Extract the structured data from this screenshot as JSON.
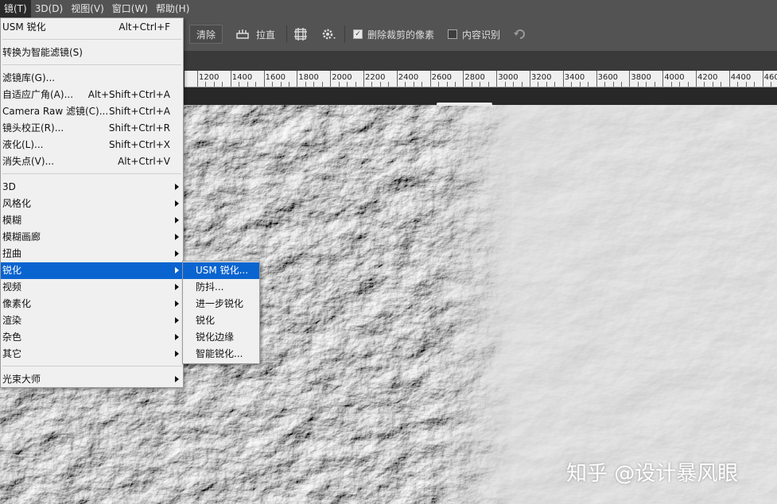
{
  "menubar": {
    "items": [
      {
        "label": "镜(T)",
        "active": true
      },
      {
        "label": "3D(D)"
      },
      {
        "label": "视图(V)"
      },
      {
        "label": "窗口(W)"
      },
      {
        "label": "帮助(H)"
      }
    ]
  },
  "options_bar": {
    "clear_label": "清除",
    "straighten_label": "拉直",
    "delete_cropped_label": "删除裁剪的像素",
    "delete_cropped_checked": true,
    "content_aware_label": "内容识别",
    "content_aware_checked": false
  },
  "ruler": {
    "labels": [
      "1200",
      "1400",
      "1600",
      "1800",
      "2000",
      "2200",
      "2400",
      "2600",
      "2800",
      "3000",
      "3200",
      "3400",
      "3600",
      "3800",
      "4000",
      "4200",
      "4400",
      "460"
    ]
  },
  "filter_menu": {
    "items": [
      {
        "label": "USM 锐化",
        "shortcut": "Alt+Ctrl+F"
      },
      {
        "label": "转换为智能滤镜(S)"
      },
      {
        "label": "滤镜库(G)..."
      },
      {
        "label": "自适应广角(A)...",
        "shortcut": "Alt+Shift+Ctrl+A"
      },
      {
        "label": "Camera Raw 滤镜(C)...",
        "shortcut": "Shift+Ctrl+A"
      },
      {
        "label": "镜头校正(R)...",
        "shortcut": "Shift+Ctrl+R"
      },
      {
        "label": "液化(L)...",
        "shortcut": "Shift+Ctrl+X"
      },
      {
        "label": "消失点(V)...",
        "shortcut": "Alt+Ctrl+V"
      },
      {
        "label": "3D"
      },
      {
        "label": "风格化"
      },
      {
        "label": "模糊"
      },
      {
        "label": "模糊画廊"
      },
      {
        "label": "扭曲"
      },
      {
        "label": "锐化",
        "highlighted": true
      },
      {
        "label": "视频"
      },
      {
        "label": "像素化"
      },
      {
        "label": "渲染"
      },
      {
        "label": "杂色"
      },
      {
        "label": "其它"
      },
      {
        "label": "光束大师"
      }
    ]
  },
  "sharpen_submenu": {
    "items": [
      {
        "label": "USM 锐化...",
        "highlighted": true
      },
      {
        "label": "防抖..."
      },
      {
        "label": "进一步锐化"
      },
      {
        "label": "锐化"
      },
      {
        "label": "锐化边缘"
      },
      {
        "label": "智能锐化..."
      }
    ]
  },
  "watermark": "知乎 @设计暴风眼",
  "colors": {
    "highlight": "#0a64d0",
    "menubar": "#535353",
    "menu_bg": "#f0f0f0"
  }
}
